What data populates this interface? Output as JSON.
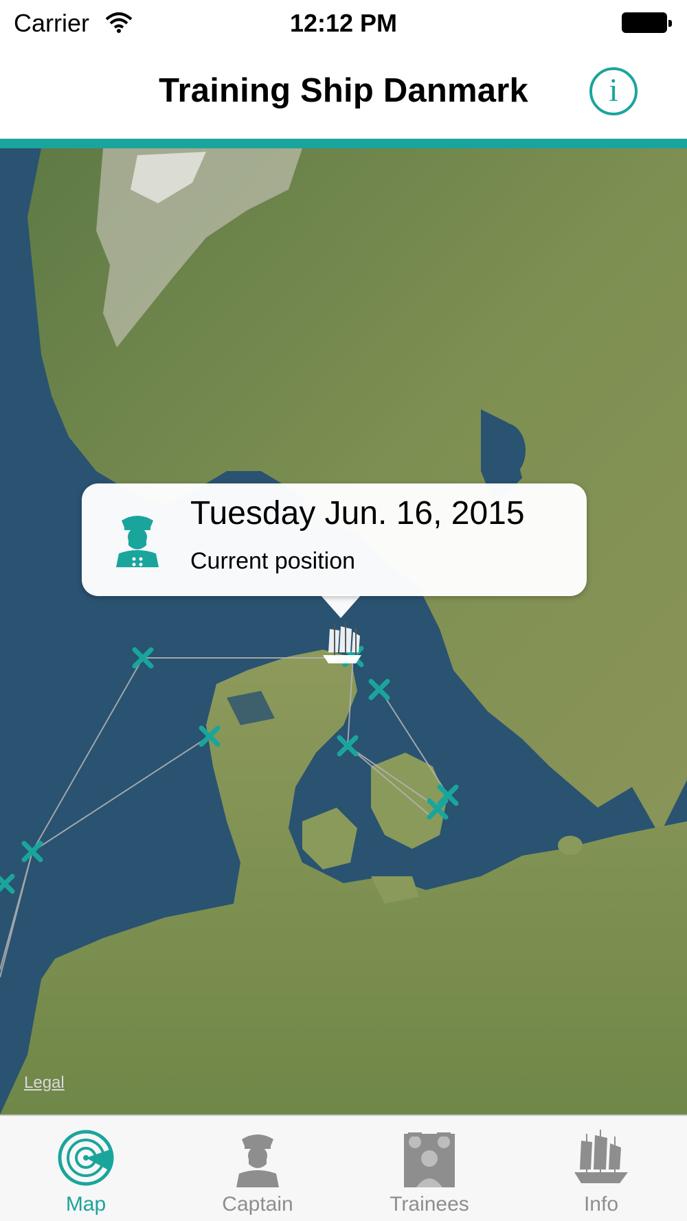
{
  "status_bar": {
    "carrier": "Carrier",
    "time": "12:12 PM",
    "wifi_icon": "wifi-icon",
    "battery_icon": "battery-icon"
  },
  "nav": {
    "title": "Training Ship Danmark",
    "info_icon_glyph": "i"
  },
  "map": {
    "legal": "Legal",
    "callout": {
      "title": "Tuesday Jun. 16, 2015",
      "subtitle": "Current position",
      "icon": "captain-icon"
    },
    "ship_icon": "ship-icon",
    "waypoint_icon": "x-marker-icon"
  },
  "tabs": [
    {
      "label": "Map",
      "icon": "radar-icon",
      "active": true
    },
    {
      "label": "Captain",
      "icon": "captain-icon",
      "active": false
    },
    {
      "label": "Trainees",
      "icon": "trainees-icon",
      "active": false
    },
    {
      "label": "Info",
      "icon": "ship-icon",
      "active": false
    }
  ],
  "colors": {
    "accent": "#1aa59c",
    "sea": "#2a5271",
    "land": "#7a8f4f",
    "inactive_tab": "#8e8e8e"
  }
}
